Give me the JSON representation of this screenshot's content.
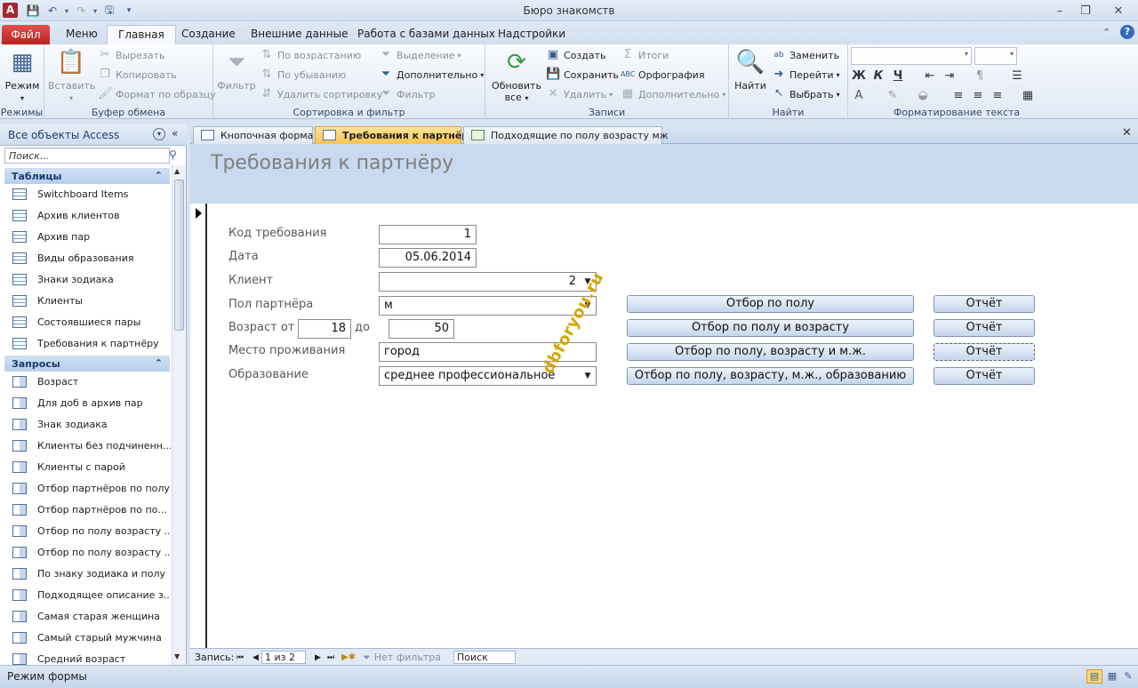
{
  "window": {
    "title": "Бюро знакомств",
    "controls": [
      "minimize-icon",
      "restore-icon",
      "close-icon"
    ]
  },
  "ribbon_tabs": [
    {
      "label": "Файл"
    },
    {
      "label": "Меню"
    },
    {
      "label": "Главная",
      "active": true
    },
    {
      "label": "Создание"
    },
    {
      "label": "Внешние данные"
    },
    {
      "label": "Работа с базами данных"
    },
    {
      "label": "Надстройки"
    }
  ],
  "ribbon": {
    "views": {
      "group": "Режимы",
      "view": "Режим"
    },
    "clipboard": {
      "group": "Буфер обмена",
      "paste": "Вставить",
      "cut": "Вырезать",
      "copy": "Копировать",
      "format_painter": "Формат по образцу"
    },
    "sort_filter": {
      "group": "Сортировка и фильтр",
      "filter": "Фильтр",
      "ascending": "По возрастанию",
      "descending": "По убыванию",
      "remove_sort": "Удалить сортировку",
      "selection": "Выделение",
      "advanced": "Дополнительно",
      "toggle_filter": "Фильтр"
    },
    "records": {
      "group": "Записи",
      "refresh": "Обновить все",
      "new": "Создать",
      "save": "Сохранить",
      "delete": "Удалить",
      "totals": "Итоги",
      "spelling": "Орфография",
      "more": "Дополнительно"
    },
    "find": {
      "group": "Найти",
      "find": "Найти",
      "replace": "Заменить",
      "goto": "Перейти",
      "select": "Выбрать"
    },
    "text_format": {
      "group": "Форматирование текста",
      "bold": "Ж",
      "italic": "К",
      "underline": "Ч",
      "font_color": "А"
    }
  },
  "nav_pane": {
    "title": "Все объекты Access",
    "search_placeholder": "Поиск...",
    "sections": [
      {
        "title": "Таблицы",
        "items": [
          "Switchboard Items",
          "Архив клиентов",
          "Архив пар",
          "Виды образования",
          "Знаки зодиака",
          "Клиенты",
          "Состоявшиеся пары",
          "Требования к партнёру"
        ]
      },
      {
        "title": "Запросы",
        "items": [
          "Возраст",
          "Для  доб в архив пар",
          "Знак зодиака",
          "Клиенты без подчиненн...",
          "Клиенты с парой",
          "Отбор партнёров по полу",
          "Отбор партнёров по по...",
          "Отбор по полу  возрасту ...",
          "Отбор по полу  возрасту ...",
          "По знаку зодиака и полу",
          "Подходящее описание з...",
          "Самая старая женщина",
          "Самый старый мужчина",
          "Средний возраст"
        ]
      }
    ]
  },
  "doc_tabs": [
    {
      "label": "Кнопочная форма"
    },
    {
      "label": "Требования к партнёру",
      "active": true
    },
    {
      "label": "Подходящие по полу возрасту мж"
    }
  ],
  "form": {
    "title": "Требования к партнёру",
    "labels": {
      "code": "Код требования",
      "date": "Дата",
      "client": "Клиент",
      "gender": "Пол партнёра",
      "age_from": "Возраст от",
      "age_to": "до",
      "residence": "Место проживания",
      "education": "Образование"
    },
    "values": {
      "code": "1",
      "date": "05.06.2014",
      "client": "2",
      "gender": "м",
      "age_from": "18",
      "age_to": "50",
      "residence": "город",
      "education": "среднее профессиональное"
    },
    "buttons": {
      "by_gender": "Отбор по полу",
      "by_gender_age": "Отбор по полу и возрасту",
      "by_gender_age_res": "Отбор по полу, возрасту и м.ж.",
      "by_gender_age_res_edu": "Отбор по полу, возрасту, м.ж., образованию",
      "report": "Отчёт"
    },
    "watermark": "dbforyou.ru"
  },
  "record_nav": {
    "label": "Запись:",
    "position": "1 из 2",
    "filter": "Нет фильтра",
    "search": "Поиск"
  },
  "status": {
    "text": "Режим формы"
  }
}
